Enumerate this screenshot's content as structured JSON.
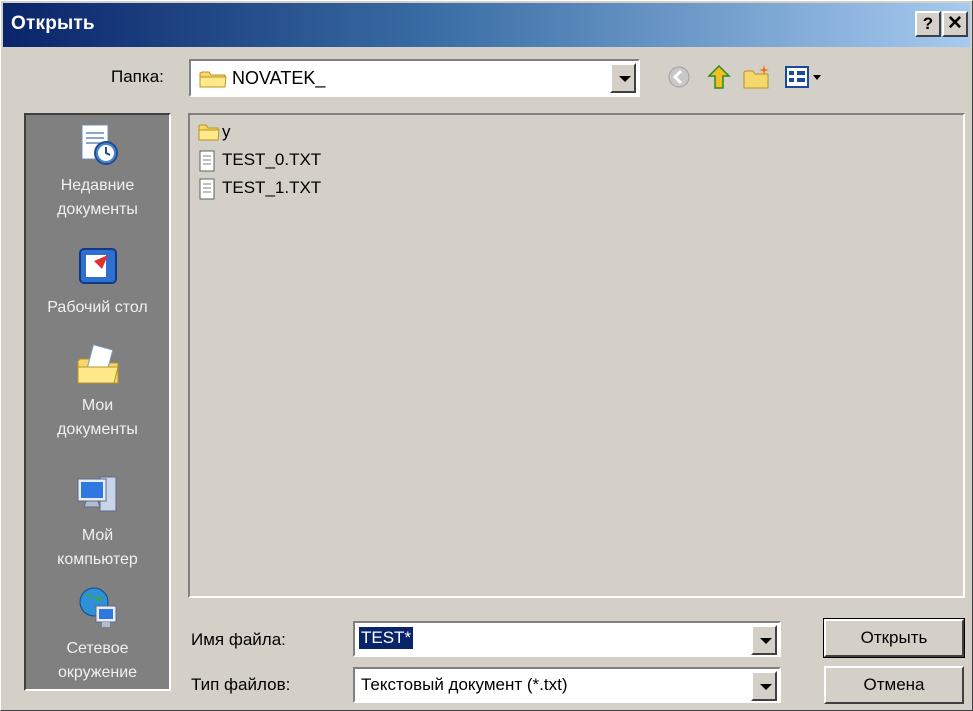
{
  "window": {
    "title": "Открыть",
    "help_label": "?",
    "close_label": "✕"
  },
  "lookin": {
    "label": "Папка:",
    "value": "NOVATEK_"
  },
  "toolbar": {
    "icons": [
      "back-icon",
      "up-folder-icon",
      "new-folder-icon",
      "views-menu-icon"
    ]
  },
  "places": [
    {
      "label_line1": "Недавние",
      "label_line2": "документы",
      "icon": "recent-documents-icon"
    },
    {
      "label_line1": "Рабочий стол",
      "label_line2": "",
      "icon": "desktop-icon"
    },
    {
      "label_line1": "Мои",
      "label_line2": "документы",
      "icon": "my-documents-icon"
    },
    {
      "label_line1": "Мой",
      "label_line2": "компьютер",
      "icon": "my-computer-icon"
    },
    {
      "label_line1": "Сетевое",
      "label_line2": "окружение",
      "icon": "network-icon"
    }
  ],
  "files": [
    {
      "name": "y",
      "type": "folder"
    },
    {
      "name": "TEST_0.TXT",
      "type": "text"
    },
    {
      "name": "TEST_1.TXT",
      "type": "text"
    }
  ],
  "filename": {
    "label": "Имя файла:",
    "value": "TEST*"
  },
  "filetype": {
    "label": "Тип файлов:",
    "value": "Текстовый документ (*.txt)"
  },
  "buttons": {
    "open": "Открыть",
    "cancel": "Отмена"
  },
  "colors": {
    "title_start": "#0a246a",
    "title_end": "#a6caf0",
    "face": "#d4d0c8",
    "places_bg": "#808080",
    "selection": "#0a246a"
  }
}
